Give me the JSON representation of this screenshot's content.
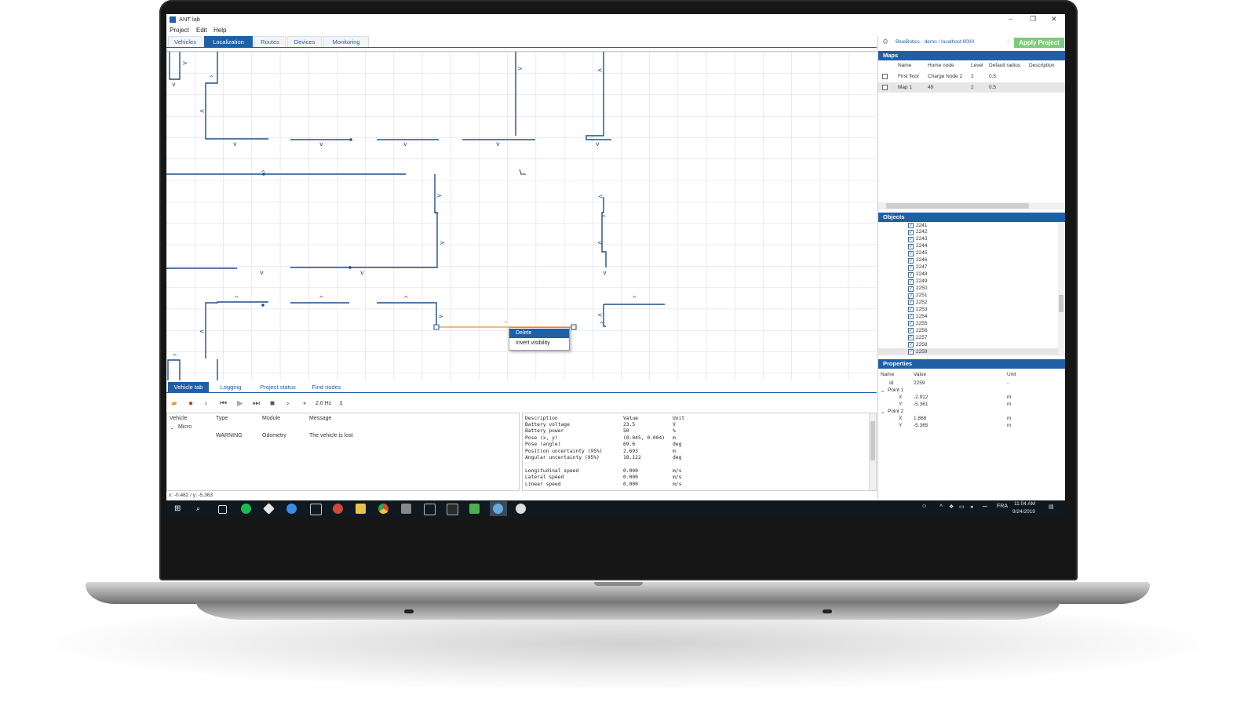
{
  "app": {
    "title": "ANT lab",
    "menu": [
      "Project",
      "Edit",
      "Help"
    ],
    "tabs": [
      "Vehicles",
      "Localization",
      "Routes",
      "Devices",
      "Monitoring"
    ],
    "active_tab": "Localization",
    "connection": "BlueBotics - demo / localhost:9000",
    "apply_label": "Apply Project"
  },
  "context_menu": {
    "items": [
      "Delete",
      "Invert visibility"
    ],
    "selected": "Delete"
  },
  "bottom_tabs": [
    "Vehicle tab",
    "Logging",
    "Project status",
    "Find nodes"
  ],
  "toolbar": {
    "rate": "2.0 Hz"
  },
  "vehicle_table": {
    "headers": [
      "Vehicle",
      "Type",
      "Module",
      "Message"
    ],
    "group": "Micro",
    "row": {
      "type": "WARNING",
      "module": "Odometry",
      "message": "The vehicle is lost"
    }
  },
  "status_table": {
    "headers": [
      "Description",
      "Value",
      "Unit"
    ],
    "rows": [
      [
        "Battery voltage",
        "23.5",
        "V"
      ],
      [
        "Battery power",
        "50",
        "%"
      ],
      [
        "Pose (x, y)",
        "(0.045, 0.004)",
        "m"
      ],
      [
        "Pose (angle)",
        "69.6",
        "deg"
      ],
      [
        "Position uncertainty (95%)",
        "2.693",
        "m"
      ],
      [
        "Angular uncertainty (95%)",
        "18.122",
        "deg"
      ],
      [
        "",
        "",
        ""
      ],
      [
        "Longitudinal speed",
        "0.000",
        "m/s"
      ],
      [
        "Lateral speed",
        "0.000",
        "m/s"
      ],
      [
        "Linear speed",
        "0.000",
        "m/s"
      ]
    ]
  },
  "status_bar": "x: -0.482 / y: -5.363",
  "maps": {
    "title": "Maps",
    "headers": [
      "Name",
      "Home node",
      "Level",
      "Default radius",
      "Description"
    ],
    "rows": [
      [
        "First floor",
        "Charge Node 2",
        "2",
        "0.5",
        ""
      ],
      [
        "Map 1",
        "49",
        "2",
        "0.5",
        ""
      ]
    ]
  },
  "objects": {
    "title": "Objects",
    "items": [
      "2241",
      "2242",
      "2243",
      "2244",
      "2245",
      "2246",
      "2247",
      "2248",
      "2249",
      "2250",
      "2251",
      "2252",
      "2253",
      "2254",
      "2255",
      "2256",
      "2257",
      "2258",
      "2259"
    ]
  },
  "properties": {
    "title": "Properties",
    "headers": [
      "Name",
      "Value",
      "Unit"
    ],
    "id_label": "Id",
    "id_value": "2259",
    "id_unit": "-",
    "point1": {
      "label": "Point 1",
      "x": "-2.912",
      "y": "-5.361",
      "unit": "m"
    },
    "point2": {
      "label": "Point 2",
      "x": "1.868",
      "y": "-5.365",
      "unit": "m"
    }
  },
  "taskbar": {
    "time": "11:04 AM",
    "date": "9/24/2019",
    "lang": "FRA"
  }
}
